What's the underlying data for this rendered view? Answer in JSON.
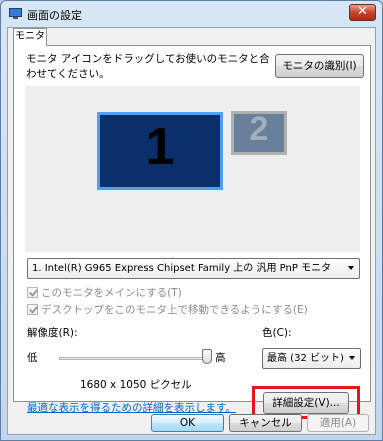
{
  "window": {
    "title": "画面の設定",
    "close_glyph": "✕"
  },
  "tabs": [
    {
      "label": "モニタ"
    }
  ],
  "instruction": "モニタ アイコンをドラッグしてお使いのモニタと合わせてください。",
  "identify_button": "モニタの識別(I)",
  "monitors": [
    {
      "number": "1",
      "selected": true
    },
    {
      "number": "2",
      "selected": false
    }
  ],
  "display_select": {
    "value": "1. Intel(R)  G965 Express Chipset Family 上の 汎用 PnP モニタ"
  },
  "checkboxes": [
    {
      "label": "このモニタをメインにする(T)",
      "checked": true,
      "disabled": true
    },
    {
      "label": "デスクトップをこのモニタ上で移動できるようにする(E)",
      "checked": true,
      "disabled": true
    }
  ],
  "resolution": {
    "label": "解像度(R):",
    "low": "低",
    "high": "高",
    "value_text": "1680 x 1050 ピクセル",
    "slider_level": 1.0
  },
  "color": {
    "label": "色(C):",
    "value": "最高 (32 ビット)"
  },
  "help_link": "最適な表示を得るための詳細を表示します。",
  "advanced_button": "詳細設定(V)...",
  "footer": {
    "ok": "OK",
    "cancel": "キャンセル",
    "apply": "適用(A)"
  },
  "colors": {
    "highlight": "#e8141c",
    "link": "#0066cc",
    "monitor_selected": "#0b2f6a",
    "monitor_border": "#4da0f2"
  }
}
